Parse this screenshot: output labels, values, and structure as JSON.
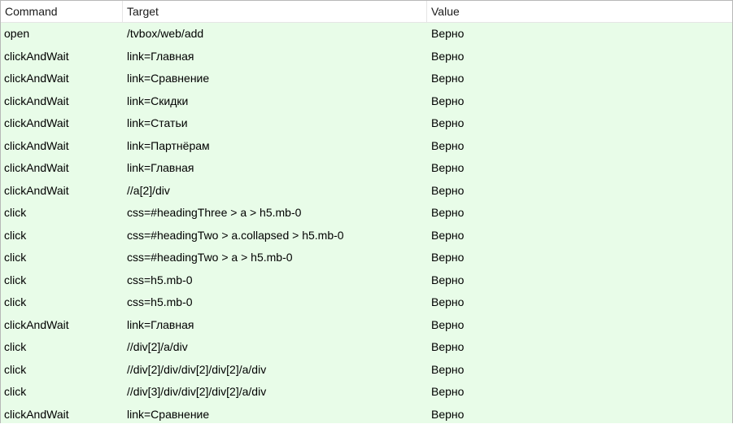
{
  "columns": {
    "command": "Command",
    "target": "Target",
    "value": "Value"
  },
  "row_bg": "#e8fce8",
  "rows": [
    {
      "command": "open",
      "target": "/tvbox/web/add",
      "value": "Верно"
    },
    {
      "command": "clickAndWait",
      "target": "link=Главная",
      "value": "Верно"
    },
    {
      "command": "clickAndWait",
      "target": "link=Сравнение",
      "value": "Верно"
    },
    {
      "command": "clickAndWait",
      "target": "link=Скидки",
      "value": "Верно"
    },
    {
      "command": "clickAndWait",
      "target": "link=Статьи",
      "value": "Верно"
    },
    {
      "command": "clickAndWait",
      "target": "link=Партнёрам",
      "value": "Верно"
    },
    {
      "command": "clickAndWait",
      "target": "link=Главная",
      "value": "Верно"
    },
    {
      "command": "clickAndWait",
      "target": "//a[2]/div",
      "value": "Верно"
    },
    {
      "command": "click",
      "target": "css=#headingThree > a > h5.mb-0",
      "value": "Верно"
    },
    {
      "command": "click",
      "target": "css=#headingTwo > a.collapsed > h5.mb-0",
      "value": "Верно"
    },
    {
      "command": "click",
      "target": "css=#headingTwo > a > h5.mb-0",
      "value": "Верно"
    },
    {
      "command": "click",
      "target": "css=h5.mb-0",
      "value": "Верно"
    },
    {
      "command": "click",
      "target": "css=h5.mb-0",
      "value": "Верно"
    },
    {
      "command": "clickAndWait",
      "target": "link=Главная",
      "value": "Верно"
    },
    {
      "command": "click",
      "target": "//div[2]/a/div",
      "value": "Верно"
    },
    {
      "command": "click",
      "target": "//div[2]/div/div[2]/div[2]/a/div",
      "value": "Верно"
    },
    {
      "command": "click",
      "target": "//div[3]/div/div[2]/div[2]/a/div",
      "value": "Верно"
    },
    {
      "command": "clickAndWait",
      "target": "link=Сравнение",
      "value": "Верно"
    }
  ]
}
